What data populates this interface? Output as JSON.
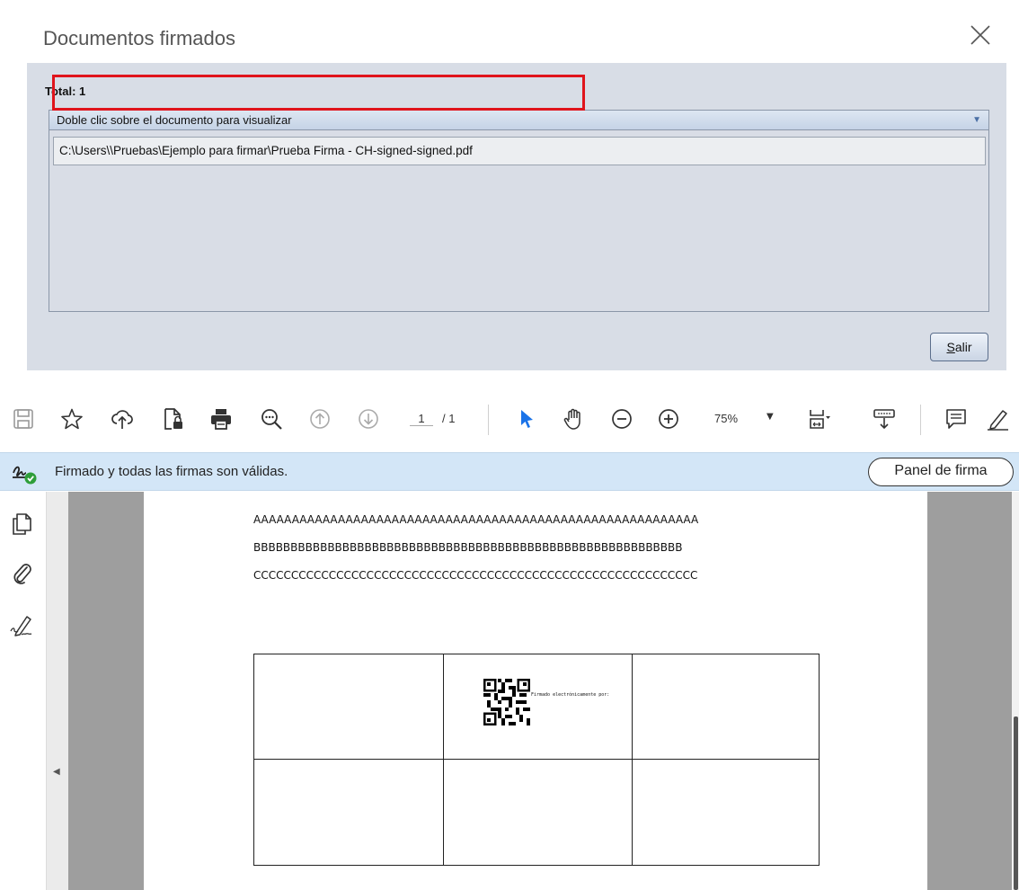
{
  "dialog": {
    "title": "Documentos firmados",
    "total_label": "Total: 1",
    "list_header": "Doble clic sobre el documento para visualizar",
    "list_items": [
      "C:\\Users\\\\Pruebas\\Ejemplo para firmar\\Prueba Firma - CH-signed-signed.pdf"
    ],
    "exit_button_mnemonic": "S",
    "exit_button_rest": "alir"
  },
  "toolbar": {
    "page_current": "1",
    "page_total": "/ 1",
    "zoom": "75%",
    "icons": [
      "save-icon",
      "star-icon",
      "upload-cloud-icon",
      "protect-file-icon",
      "print-icon",
      "zoom-search-icon",
      "page-up-icon",
      "page-down-icon",
      "select-arrow-icon",
      "hand-icon",
      "zoom-out-icon",
      "zoom-in-icon",
      "fit-page-icon",
      "scroll-mode-icon",
      "comment-icon",
      "highlight-pen-icon"
    ]
  },
  "signature_bar": {
    "status_text": "Firmado y todas las firmas son válidas.",
    "panel_button": "Panel de firma"
  },
  "left_rail": {
    "icons": [
      "pages-icon",
      "attachment-icon",
      "signature-pen-icon"
    ]
  },
  "pdf_page": {
    "line1": "AAAAAAAAAAAAAAAAAAAAAAAAAAAAAAAAAAAAAAAAAAAAAAAAAAAAAAAAAA",
    "line2": "BBBBBBBBBBBBBBBBBBBBBBBBBBBBBBBBBBBBBBBBBBBBBBBBBBBBBBBBBB",
    "line3": "CCCCCCCCCCCCCCCCCCCCCCCCCCCCCCCCCCCCCCCCCCCCCCCCCCCCCCCCCCC",
    "qr_caption": "Firmado electrónicamente por:"
  },
  "colors": {
    "dialog_body": "#d8dde6",
    "highlight_border": "#e0141c",
    "signature_bar": "#d3e6f7",
    "select_arrow": "#1a73e8",
    "page_gutter": "#9e9e9e"
  }
}
